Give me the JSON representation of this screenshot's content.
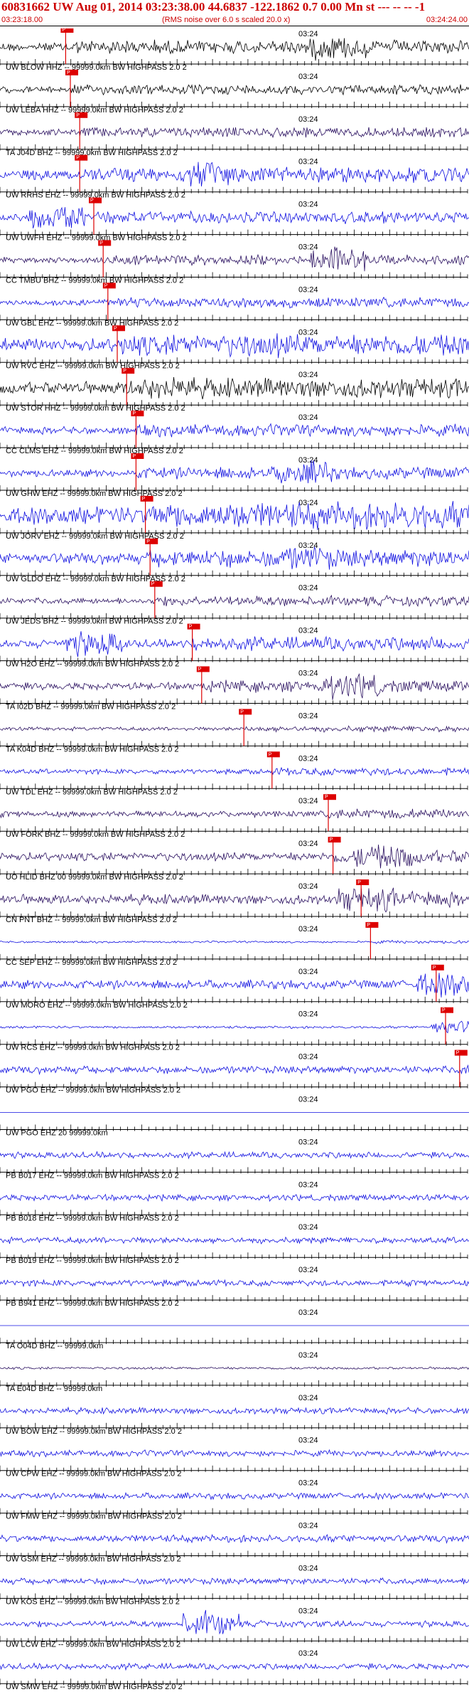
{
  "header": {
    "title": "60831662 UW Aug 01, 2014 03:23:38.00   44.6837 -122.1862  0.7 0.00 Mn st --- -- --  -1",
    "start_time": "03:23:18.00",
    "note": "(RMS noise over 6.0 s scaled 20.0 x)",
    "end_time": "03:24:24.00"
  },
  "time_marker": "03:24",
  "pick_label": "P",
  "colors": {
    "header_text": "#cc0000",
    "trace_blue": "#1010e0",
    "trace_black": "#000000",
    "trace_purple": "#2a1060",
    "pick": "#dd0000"
  },
  "traces": [
    {
      "label": "UW BLOW HHZ -- 99999.0km BW  HIGHPASS  2.0  2",
      "color": "#000000",
      "pick": 0.14,
      "amp": 0.35,
      "burst": 0.72
    },
    {
      "label": "UW LEBA HHZ -- 99999.0km BW  HIGHPASS  2.0  2",
      "color": "#000000",
      "pick": 0.15,
      "amp": 0.25,
      "burst": 0
    },
    {
      "label": "TA J04D BHZ -- 99999.0km BW  HIGHPASS  2.0  2",
      "color": "#2a1060",
      "pick": 0.17,
      "amp": 0.25,
      "burst": 0
    },
    {
      "label": "UW RRHS EHZ -- 99999.0km BW  HIGHPASS  2.0  2",
      "color": "#1010e0",
      "pick": 0.17,
      "amp": 0.4,
      "burst": 0.45
    },
    {
      "label": "UW UWFH EHZ -- 99999.0km BW  HIGHPASS  2.0  2",
      "color": "#1010e0",
      "pick": 0.2,
      "amp": 0.3,
      "burst": 0.12
    },
    {
      "label": "CC TMBU BHZ -- 99999.0km BW  HIGHPASS  2.0  2",
      "color": "#2a1060",
      "pick": 0.22,
      "amp": 0.25,
      "burst": 0.72
    },
    {
      "label": "UW GBL EHZ -- 99999.0km BW  HIGHPASS  2.0  2",
      "color": "#1010e0",
      "pick": 0.23,
      "amp": 0.25,
      "burst": 0
    },
    {
      "label": "UW RVC EHZ -- 99999.0km BW  HIGHPASS  2.0  2",
      "color": "#1010e0",
      "pick": 0.25,
      "amp": 0.55,
      "burst": 0.55
    },
    {
      "label": "UW STOR HHZ -- 99999.0km BW  HIGHPASS  2.0  2",
      "color": "#000000",
      "pick": 0.27,
      "amp": 0.5,
      "burst": 0.35
    },
    {
      "label": "CC CLMS EHZ -- 99999.0km BW  HIGHPASS  2.0  2",
      "color": "#1010e0",
      "pick": 0.29,
      "amp": 0.3,
      "burst": 0
    },
    {
      "label": "UW GHW EHZ -- 99999.0km BW  HIGHPASS  2.0  2",
      "color": "#1010e0",
      "pick": 0.29,
      "amp": 0.3,
      "burst": 0.65
    },
    {
      "label": "UW JORV EHZ -- 99999.0km BW  HIGHPASS  2.0  2",
      "color": "#1010e0",
      "pick": 0.31,
      "amp": 0.7,
      "burst": 0
    },
    {
      "label": "UW GLDO EHZ -- 99999.0km BW  HIGHPASS  2.0  2",
      "color": "#1010e0",
      "pick": 0.32,
      "amp": 0.45,
      "burst": 0.65
    },
    {
      "label": "UW JEDS BHZ -- 99999.0km BW  HIGHPASS  2.0  2",
      "color": "#2a1060",
      "pick": 0.33,
      "amp": 0.25,
      "burst": 0
    },
    {
      "label": "UW H2O EHZ -- 99999.0km BW  HIGHPASS  2.0  2",
      "color": "#1010e0",
      "pick": 0.41,
      "amp": 0.35,
      "burst": 0.2
    },
    {
      "label": "TA I02D BHZ -- 99999.0km BW  HIGHPASS  2.0  2",
      "color": "#2a1060",
      "pick": 0.43,
      "amp": 0.3,
      "burst": 0.75
    },
    {
      "label": "TA K04D BHZ -- 99999.0km BW  HIGHPASS  2.0  2",
      "color": "#2a1060",
      "pick": 0.52,
      "amp": 0.15,
      "burst": 0
    },
    {
      "label": "UW TDL EHZ -- 99999.0km BW  HIGHPASS  2.0  2",
      "color": "#1010e0",
      "pick": 0.58,
      "amp": 0.2,
      "burst": 0
    },
    {
      "label": "UW FORK BHZ -- 99999.0km BW  HIGHPASS  2.0  2",
      "color": "#2a1060",
      "pick": 0.7,
      "amp": 0.25,
      "burst": 0
    },
    {
      "label": "UO HLID BHZ 00 99999.0km BW  HIGHPASS  2.0  2",
      "color": "#2a1060",
      "pick": 0.71,
      "amp": 0.35,
      "burst": 0.82
    },
    {
      "label": "CN PNT BHZ -- 99999.0km BW  HIGHPASS  2.0  2",
      "color": "#2a1060",
      "pick": 0.77,
      "amp": 0.4,
      "burst": 0.78
    },
    {
      "label": "CC SEP EHZ -- 99999.0km BW  HIGHPASS  2.0  2",
      "color": "#1010e0",
      "pick": 0.79,
      "amp": 0.08,
      "burst": 0
    },
    {
      "label": "UW MORO EHZ -- 99999.0km BW  HIGHPASS  2.0  2",
      "color": "#1010e0",
      "pick": 0.93,
      "amp": 0.35,
      "burst": 0.95
    },
    {
      "label": "UW RCS EHZ -- 99999.0km BW  HIGHPASS  2.0  2",
      "color": "#1010e0",
      "pick": 0.95,
      "amp": 0.1,
      "burst": 0.98
    },
    {
      "label": "UW PGO EHZ -- 99999.0km BW  HIGHPASS  2.0  2",
      "color": "#1010e0",
      "pick": 0.98,
      "amp": 0.3,
      "burst": 0
    },
    {
      "label": "UW PGO EHZ 20 99999.0km",
      "color": "#1010e0",
      "pick": -1,
      "amp": 0,
      "burst": 0
    },
    {
      "label": "PB B017 EHZ -- 99999.0km BW  HIGHPASS  2.0  2",
      "color": "#1010e0",
      "pick": -1,
      "amp": 0.25,
      "burst": 0
    },
    {
      "label": "PB B018 EHZ -- 99999.0km BW  HIGHPASS  2.0  2",
      "color": "#1010e0",
      "pick": -1,
      "amp": 0.25,
      "burst": 0
    },
    {
      "label": "PB B019 EHZ -- 99999.0km BW  HIGHPASS  2.0  2",
      "color": "#1010e0",
      "pick": -1,
      "amp": 0.25,
      "burst": 0
    },
    {
      "label": "PB B941 EHZ -- 99999.0km BW  HIGHPASS  2.0  2",
      "color": "#1010e0",
      "pick": -1,
      "amp": 0.25,
      "burst": 0
    },
    {
      "label": "TA O04D BHZ -- 99999.0km",
      "color": "#1010e0",
      "pick": -1,
      "amp": 0,
      "burst": 0
    },
    {
      "label": "TA E04D BHZ -- 99999.0km",
      "color": "#2a1060",
      "pick": -1,
      "amp": 0.1,
      "burst": 0
    },
    {
      "label": "UW BOW EHZ -- 99999.0km BW  HIGHPASS  2.0  2",
      "color": "#1010e0",
      "pick": -1,
      "amp": 0.25,
      "burst": 0
    },
    {
      "label": "UW CPW EHZ -- 99999.0km BW  HIGHPASS  2.0  2",
      "color": "#1010e0",
      "pick": -1,
      "amp": 0.25,
      "burst": 0
    },
    {
      "label": "UW FMW EHZ -- 99999.0km BW  HIGHPASS  2.0  2",
      "color": "#1010e0",
      "pick": -1,
      "amp": 0.25,
      "burst": 0
    },
    {
      "label": "UW GSM EHZ -- 99999.0km BW  HIGHPASS  2.0  2",
      "color": "#1010e0",
      "pick": -1,
      "amp": 0.3,
      "burst": 0
    },
    {
      "label": "UW KOS EHZ -- 99999.0km BW  HIGHPASS  2.0  2",
      "color": "#1010e0",
      "pick": -1,
      "amp": 0.25,
      "burst": 0
    },
    {
      "label": "UW LCW EHZ -- 99999.0km BW  HIGHPASS  2.0  2",
      "color": "#1010e0",
      "pick": -1,
      "amp": 0.25,
      "burst": 0.45
    },
    {
      "label": "UW SMW EHZ -- 99999.0km BW  HIGHPASS  2.0  2",
      "color": "#1010e0",
      "pick": -1,
      "amp": 0.25,
      "burst": 0
    }
  ]
}
